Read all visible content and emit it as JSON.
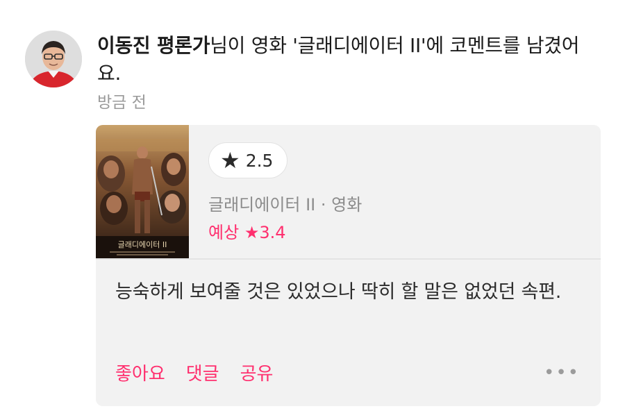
{
  "activity": {
    "author": "이동진 평론가",
    "message": "님이 영화 '글래디에이터 II'에 코멘트를 남겼어요.",
    "timestamp": "방금 전"
  },
  "card": {
    "rating": "2.5",
    "rating_icon": "star-icon",
    "movie_meta": "글래디에이터 II · 영화",
    "expected_label": "예상",
    "expected_star": "★",
    "expected_value": "3.4",
    "poster_title": "글래디에이터 II",
    "comment": "능숙하게 보여줄 것은 있었으나 딱히 할 말은 없었던 속편."
  },
  "actions": {
    "like": "좋아요",
    "reply": "댓글",
    "share": "공유",
    "more_icon": "more-dots-icon"
  },
  "colors": {
    "accent": "#ff2f6e",
    "card_bg": "#f2f2f2",
    "muted": "#9a9a9a"
  }
}
